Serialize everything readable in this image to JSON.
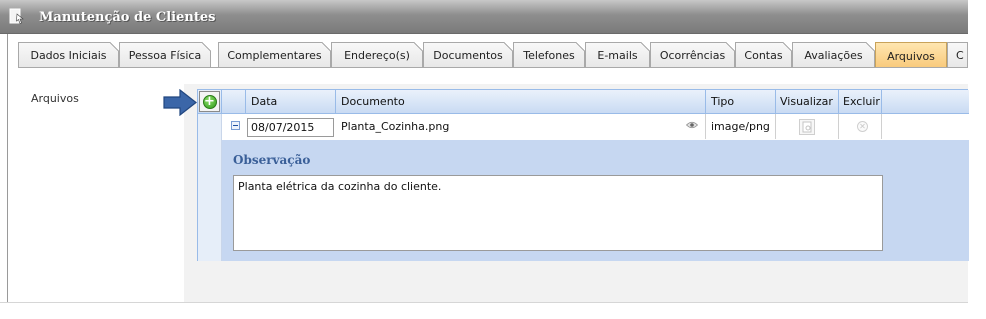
{
  "window": {
    "title": "Manutenção de Clientes"
  },
  "tabs": [
    {
      "label": "Dados Iniciais"
    },
    {
      "label": "Pessoa Física"
    },
    {
      "label": "Complementares"
    },
    {
      "label": "Endereço(s)"
    },
    {
      "label": "Documentos"
    },
    {
      "label": "Telefones"
    },
    {
      "label": "E-mails"
    },
    {
      "label": "Ocorrências"
    },
    {
      "label": "Contas"
    },
    {
      "label": "Avaliações"
    },
    {
      "label": "Arquivos"
    },
    {
      "label": "C"
    }
  ],
  "active_tab": "Arquivos",
  "section": {
    "label": "Arquivos"
  },
  "grid": {
    "columns": [
      "Data",
      "Documento",
      "Tipo",
      "Visualizar",
      "Excluir"
    ],
    "rows": [
      {
        "data": "08/07/2015",
        "documento": "Planta_Cozinha.png",
        "tipo": "image/png"
      }
    ],
    "detail": {
      "label": "Observação",
      "text": "Planta elétrica da cozinha do cliente."
    }
  },
  "colors": {
    "active_tab": "#f8c878",
    "grid_header": "#c9dbf3",
    "detail_bg": "#c6d7f1",
    "arrow": "#3b66a8"
  },
  "icons": {
    "title": "form-icon",
    "add": "add-circle-icon",
    "collapse": "minus-icon",
    "preview": "eye-icon",
    "view": "document-view-icon",
    "delete": "delete-circle-icon",
    "pointer": "arrow-right-icon"
  }
}
